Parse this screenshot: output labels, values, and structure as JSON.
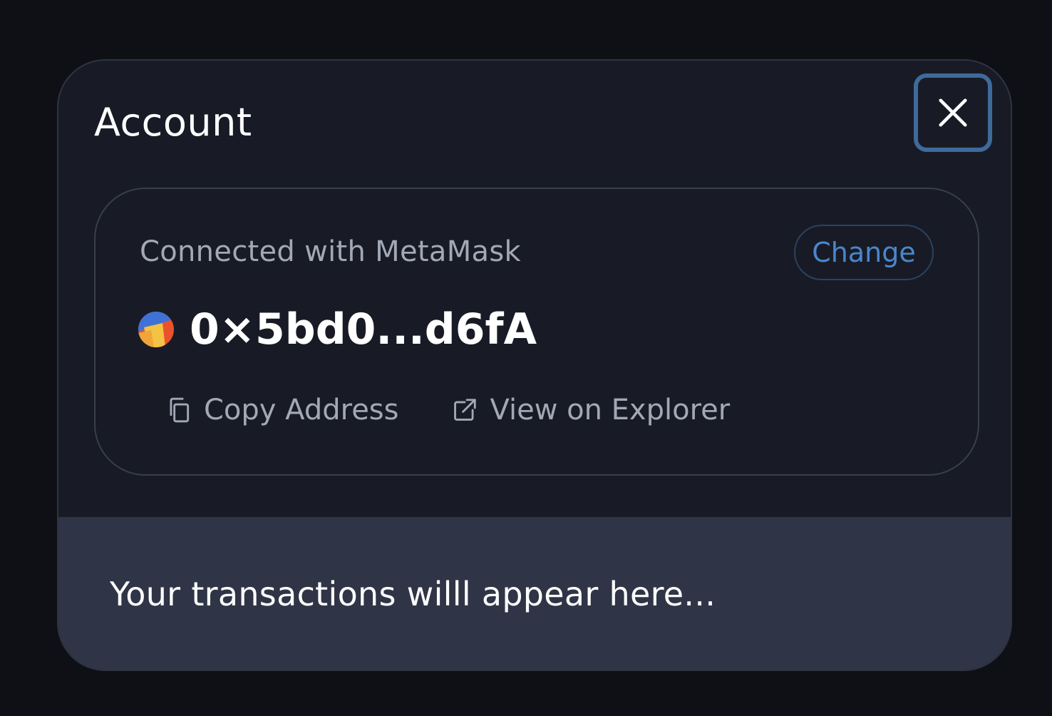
{
  "modal": {
    "title": "Account",
    "close_icon": "close-icon"
  },
  "account": {
    "connected_label": "Connected with MetaMask",
    "change_label": "Change",
    "address": "0×5bd0...d6fA",
    "avatar_icon": "identicon-avatar",
    "actions": [
      {
        "label": "Copy Address",
        "icon": "copy-icon"
      },
      {
        "label": "View on Explorer",
        "icon": "external-link-icon"
      }
    ]
  },
  "transactions": {
    "placeholder": "Your transactions willl appear here..."
  },
  "colors": {
    "background": "#0e1016",
    "modal_bg": "#181b25",
    "accent": "#4a86cd",
    "close_border": "#3e6a9c",
    "tx_bg": "#2f3546"
  }
}
